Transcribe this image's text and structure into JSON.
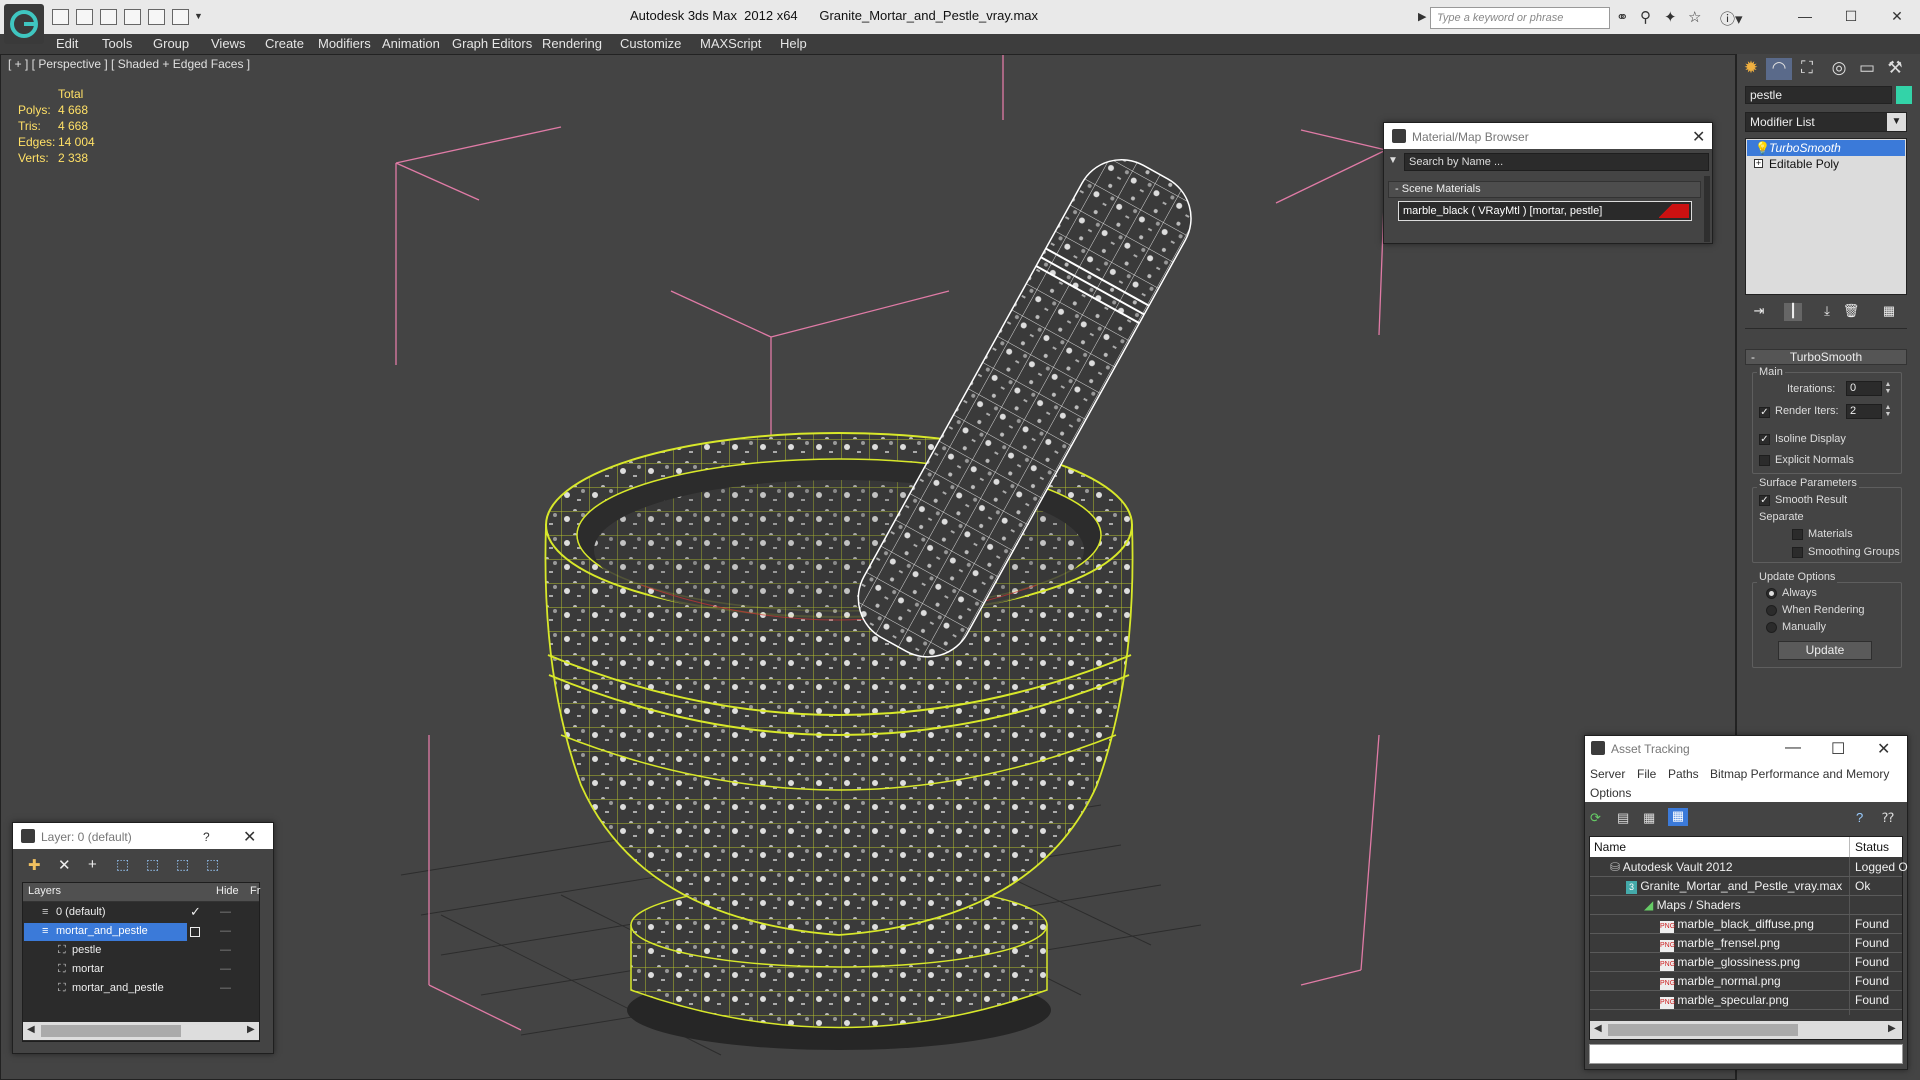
{
  "window": {
    "app_title": "Autodesk 3ds Max  2012 x64",
    "file_title": "Granite_Mortar_and_Pestle_vray.max",
    "search_placeholder": "Type a keyword or phrase"
  },
  "menu": [
    "Edit",
    "Tools",
    "Group",
    "Views",
    "Create",
    "Modifiers",
    "Animation",
    "Graph Editors",
    "Rendering",
    "Customize",
    "MAXScript",
    "Help"
  ],
  "viewport": {
    "label": "[ + ] [ Perspective ] [ Shaded + Edged Faces ]",
    "stats_header": "Total",
    "stats": [
      {
        "label": "Polys:",
        "value": "4 668"
      },
      {
        "label": "Tris:",
        "value": "4 668"
      },
      {
        "label": "Edges:",
        "value": "14 004"
      },
      {
        "label": "Verts:",
        "value": "2 338"
      }
    ]
  },
  "command_panel": {
    "object_name": "pestle",
    "object_color": "#33d3a8",
    "modifier_list_label": "Modifier List",
    "stack": [
      {
        "label": "TurboSmooth",
        "selected": true
      },
      {
        "label": "Editable Poly",
        "selected": false
      }
    ],
    "turbosmooth": {
      "title": "TurboSmooth",
      "main_label": "Main",
      "iterations_label": "Iterations:",
      "iterations_value": "0",
      "render_iters_label": "Render Iters:",
      "render_iters_value": "2",
      "render_iters_checked": true,
      "isoline_label": "Isoline Display",
      "isoline_checked": true,
      "explicit_normals_label": "Explicit Normals",
      "explicit_normals_checked": false,
      "surface_params_label": "Surface Parameters",
      "smooth_result_label": "Smooth Result",
      "smooth_result_checked": true,
      "separate_label": "Separate",
      "materials_label": "Materials",
      "smoothing_groups_label": "Smoothing Groups",
      "update_options_label": "Update Options",
      "always_label": "Always",
      "when_rendering_label": "When Rendering",
      "manually_label": "Manually",
      "update_button": "Update"
    }
  },
  "material_browser": {
    "title": "Material/Map Browser",
    "search_placeholder": "Search by Name ...",
    "section_label": "Scene Materials",
    "material": "marble_black  ( VRayMtl )  [mortar, pestle]",
    "swatch_color": "#cc1111"
  },
  "layer_panel": {
    "title": "Layer: 0 (default)",
    "help_glyph": "?",
    "columns": {
      "layers": "Layers",
      "hide": "Hide",
      "freeze": "Fr"
    },
    "rows": [
      {
        "name": "0 (default)",
        "indent": 1,
        "selected": false,
        "current": true
      },
      {
        "name": "mortar_and_pestle",
        "indent": 1,
        "selected": true,
        "current": false
      },
      {
        "name": "pestle",
        "indent": 2,
        "selected": false,
        "current": false
      },
      {
        "name": "mortar",
        "indent": 2,
        "selected": false,
        "current": false
      },
      {
        "name": "mortar_and_pestle",
        "indent": 2,
        "selected": false,
        "current": false
      }
    ]
  },
  "asset_tracking": {
    "title": "Asset Tracking",
    "menu": [
      "Server",
      "File",
      "Paths",
      "Bitmap Performance and Memory"
    ],
    "menu2": "Options",
    "columns": {
      "name": "Name",
      "status": "Status"
    },
    "rows": [
      {
        "name": "Autodesk Vault 2012",
        "status": "Logged O",
        "indent": 1,
        "icon": "vault"
      },
      {
        "name": "Granite_Mortar_and_Pestle_vray.max",
        "status": "Ok",
        "indent": 2,
        "icon": "max"
      },
      {
        "name": "Maps / Shaders",
        "status": "",
        "indent": 3,
        "icon": "maps"
      },
      {
        "name": "marble_black_diffuse.png",
        "status": "Found",
        "indent": 4,
        "icon": "png"
      },
      {
        "name": "marble_frensel.png",
        "status": "Found",
        "indent": 4,
        "icon": "png"
      },
      {
        "name": "marble_glossiness.png",
        "status": "Found",
        "indent": 4,
        "icon": "png"
      },
      {
        "name": "marble_normal.png",
        "status": "Found",
        "indent": 4,
        "icon": "png"
      },
      {
        "name": "marble_specular.png",
        "status": "Found",
        "indent": 4,
        "icon": "png"
      }
    ]
  },
  "colors": {
    "accent_blue": "#3b7ad9",
    "wire_yellow": "#d8e82a",
    "bbox_pink": "#e07ba6",
    "stats_yellow": "#ffe066"
  }
}
